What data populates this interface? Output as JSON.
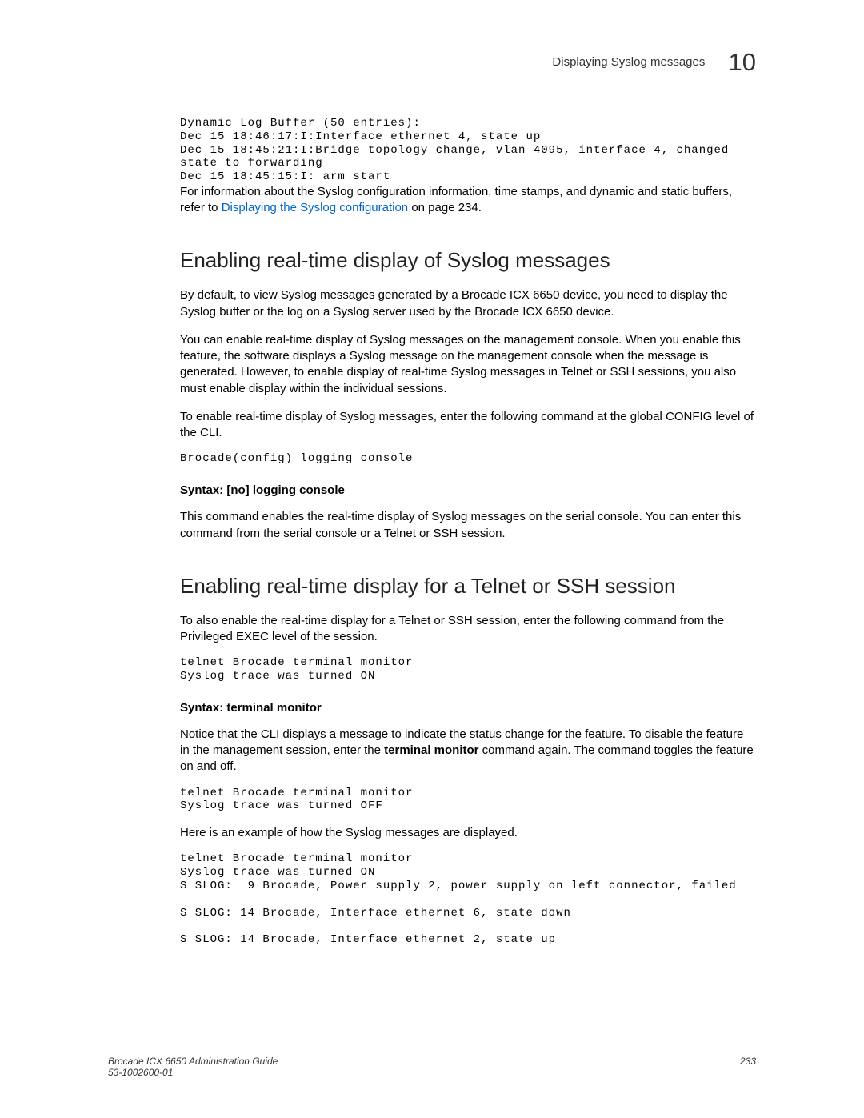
{
  "header": {
    "title": "Displaying Syslog messages",
    "chapter": "10"
  },
  "intro_log": "Dynamic Log Buffer (50 entries):\nDec 15 18:46:17:I:Interface ethernet 4, state up\nDec 15 18:45:21:I:Bridge topology change, vlan 4095, interface 4, changed\nstate to forwarding\nDec 15 18:45:15:I: arm start",
  "intro_para_1": "For information about the Syslog configuration information, time stamps, and dynamic and static buffers, refer to ",
  "intro_link": "Displaying the Syslog configuration",
  "intro_para_2": " on page 234.",
  "section1": {
    "heading": "Enabling real-time display of Syslog messages",
    "p1": "By default, to view Syslog messages generated by a Brocade ICX 6650 device, you need to display the Syslog buffer or the log on a Syslog server used by the Brocade ICX 6650 device.",
    "p2": "You can enable real-time display of Syslog messages on the management console. When you enable this feature, the software displays a Syslog message on the management console when the message is generated. However, to enable display of real-time Syslog messages in Telnet or SSH sessions, you also must enable display within the individual sessions.",
    "p3": "To enable real-time display of Syslog messages, enter the following command at the global CONFIG level of the CLI.",
    "cmd1": "Brocade(config) logging console",
    "syntax1": "Syntax: [no] logging console",
    "p4": "This command enables the real-time display of Syslog messages on the serial console. You can enter this command from the serial console or a Telnet or SSH session."
  },
  "section2": {
    "heading": "Enabling real-time display for a Telnet or SSH session",
    "p1": "To also enable the real-time display for a Telnet or SSH session, enter the following command from the Privileged EXEC level of the session.",
    "cmd1": "telnet Brocade terminal monitor\nSyslog trace was turned ON",
    "syntax1": "Syntax:  terminal monitor",
    "p2_a": "Notice that the CLI displays a message to indicate the status change for the feature. To disable the feature in the management session, enter the ",
    "p2_bold": "terminal monitor",
    "p2_b": " command again. The command toggles the feature on and off.",
    "cmd2": "telnet Brocade terminal monitor\nSyslog trace was turned OFF",
    "p3": "Here is an example of how the Syslog messages are displayed.",
    "cmd3": "telnet Brocade terminal monitor\nSyslog trace was turned ON\nS SLOG:  9 Brocade, Power supply 2, power supply on left connector, failed\n\nS SLOG: 14 Brocade, Interface ethernet 6, state down\n\nS SLOG: 14 Brocade, Interface ethernet 2, state up"
  },
  "footer": {
    "guide": "Brocade ICX 6650 Administration Guide",
    "doc_num": "53-1002600-01",
    "page": "233"
  }
}
